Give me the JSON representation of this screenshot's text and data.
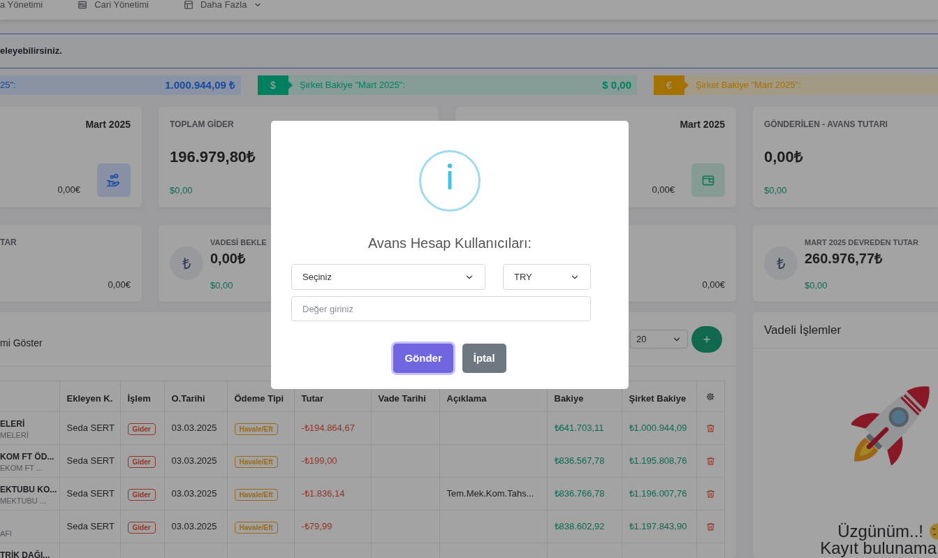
{
  "nav": [
    {
      "label": "a Yönetimi",
      "dropdown": false
    },
    {
      "label": "Cari Yönetimi",
      "dropdown": false
    },
    {
      "label": "Daha Fazla",
      "dropdown": true
    }
  ],
  "notice": {
    "text": "eleyebilirsiniz."
  },
  "balances": [
    {
      "label": "25\":",
      "amount": "1.000.944,09 ₺",
      "color": "#8a93a3"
    },
    {
      "tag": "$",
      "label": "Şirket Bakiye \"Mart 2025\":",
      "amount": "$ 0,00",
      "color": "#869d97"
    },
    {
      "tag": "€",
      "label": "Şirket Bakiye \"Mart 2025\":",
      "color": "#a39a86"
    }
  ],
  "stat_cards": [
    {
      "kind": "tile",
      "period": "Mart 2025",
      "eur": "0,00€",
      "color": "#8891a3"
    },
    {
      "kind": "plain",
      "title": "TOPLAM GİDER",
      "value": "196.979,80₺",
      "usd": "$0,00"
    },
    {
      "kind": "tile",
      "period": "Mart 2025",
      "eur": "0,00€",
      "color": "#869b93"
    },
    {
      "kind": "plain",
      "title": "GÖNDERİLEN - AVANS TUTARI",
      "value": "0,00₺",
      "usd": "$0,00"
    },
    {
      "kind": "plain",
      "title": "TAR",
      "eur": "0,00€"
    },
    {
      "kind": "lira",
      "symbol": "₺",
      "title": "VADESİ BEKLE",
      "value": "0,00₺",
      "usd": "$0,00"
    },
    {
      "kind": "plain",
      "eur": "0,00€"
    },
    {
      "kind": "lira",
      "symbol": "₺",
      "title": "MART 2025 DEVREDEN TUTAR",
      "value": "260.976,77₺",
      "usd": "$0,00"
    }
  ],
  "records": {
    "filter_label": "mi Göster",
    "page_size": "20",
    "columns": [
      "Ekleyen K.",
      "İşlem",
      "O.Tarihi",
      "Ödeme Tipi",
      "Tutar",
      "Vade Tarihi",
      "Açıklama",
      "Bakiye",
      "Şirket Bakiye"
    ],
    "rows": [
      {
        "column_1": {
          "line_1": "ELERİ",
          "line_2": "MELERİ"
        },
        "added_by": "Seda SERT",
        "operation": "Gider",
        "o_date": "03.03.2025",
        "payment_type": "Havale/Eft",
        "amount": "-₺194.864,67",
        "balance": "₺641.703,11",
        "company_balance": "₺1.000.944,09"
      },
      {
        "column_1": {
          "line_1": "KOM FT ÖD...",
          "line_2": "EKOM FT ..."
        },
        "added_by": "Seda SERT",
        "operation": "Gider",
        "o_date": "03.03.2025",
        "payment_type": "Havale/Eft",
        "amount": "-₺199,00",
        "balance": "₺836.567,78",
        "company_balance": "₺1.195.808,76"
      },
      {
        "column_1": {
          "line_1": "EKTUBU KO...",
          "line_2": "MEKTUBU ..."
        },
        "added_by": "Seda SERT",
        "operation": "Gider",
        "o_date": "03.03.2025",
        "payment_type": "Havale/Eft",
        "amount": "-₺1.836,14",
        "description": "Tem.Mek.Kom.Tahs...",
        "balance": "₺836.766,78",
        "company_balance": "₺1.196.007,76"
      },
      {
        "column_1": {
          "line_2": "AFI"
        },
        "added_by": "Seda SERT",
        "operation": "Gider",
        "o_date": "03.03.2025",
        "payment_type": "Havale/Eft",
        "amount": "-₺79,99",
        "balance": "₺838.602,92",
        "company_balance": "₺1.197.843,90"
      },
      {
        "column_1": {
          "line_1": "TRİK DAĞI..."
        }
      }
    ]
  },
  "upcoming": {
    "title": "Vadeli İşlemler",
    "empty_title": "Üzgünüm..!",
    "empty_text": "Kayıt bulunama"
  },
  "modal": {
    "title": "Avans Hesap Kullanıcıları:",
    "user_select": {
      "value": "Seçiniz"
    },
    "currency_select": {
      "value": "TRY"
    },
    "amount_input": {
      "placeholder": "Değer giriniz"
    },
    "buttons": [
      {
        "label": "Gönder",
        "kind": "confirm",
        "focused": true
      },
      {
        "label": "İptal",
        "kind": "cancel",
        "focused": false
      }
    ]
  }
}
